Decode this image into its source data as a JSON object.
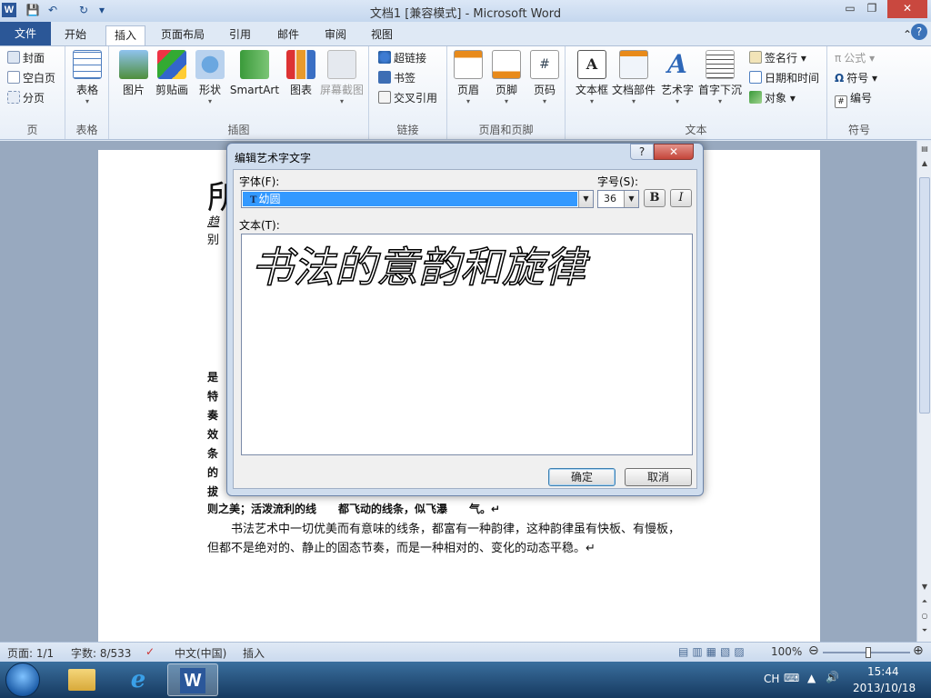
{
  "window": {
    "title": "文档1 [兼容模式] - Microsoft Word",
    "app_icon": "W"
  },
  "qat": {
    "save": "💾",
    "undo": "↶",
    "redo": "↻",
    "more": "▾"
  },
  "controls": {
    "minimize": "▭",
    "maximize": "❐",
    "close": "✕"
  },
  "tabs": [
    "文件",
    "开始",
    "插入",
    "页面布局",
    "引用",
    "邮件",
    "审阅",
    "视图"
  ],
  "ribbon": {
    "pages": {
      "label": "页",
      "items": [
        "封面",
        "空白页",
        "分页"
      ]
    },
    "tables": {
      "label": "表格",
      "button": "表格"
    },
    "illustrations": {
      "label": "插图",
      "buttons": [
        "图片",
        "剪贴画",
        "形状",
        "SmartArt",
        "图表",
        "屏幕截图"
      ]
    },
    "links": {
      "label": "链接",
      "items": [
        "超链接",
        "书签",
        "交叉引用"
      ]
    },
    "header_footer": {
      "label": "页眉和页脚",
      "buttons": [
        "页眉",
        "页脚",
        "页码"
      ]
    },
    "text": {
      "label": "文本",
      "buttons": [
        "文本框",
        "文档部件",
        "艺术字",
        "首字下沉"
      ],
      "items": [
        "签名行",
        "日期和时间",
        "对象"
      ]
    },
    "symbols": {
      "label": "符号",
      "items": [
        "公式",
        "符号",
        "编号"
      ]
    }
  },
  "document": {
    "fragment_1": "所",
    "fragment_2": "趋",
    "fragment_3": "别",
    "left_chars": [
      "是",
      "特",
      "奏",
      "效",
      "条",
      "的",
      "拔"
    ],
    "line_partial": "则之美；活泼流利的线　　都飞动的线条，似飞瀑　　气。↵",
    "para_line1": "　　书法艺术中一切优美而有意味的线条，都富有一种韵律，这种韵律虽有快板、有慢板，",
    "para_line2": "但都不是绝对的、静止的固态节奏，而是一种相对的、变化的动态平稳。↵"
  },
  "dialog": {
    "title": "编辑艺术字文字",
    "help": "?",
    "close": "✕",
    "font_label": "字体(F):",
    "font_value": "幼圆",
    "size_label": "字号(S):",
    "size_value": "36",
    "bold": "B",
    "italic": "I",
    "text_label": "文本(T):",
    "text_value": "书法的意韵和旋律",
    "ok": "确定",
    "cancel": "取消"
  },
  "status": {
    "page": "页面: 1/1",
    "words": "字数: 8/533",
    "language": "中文(中国)",
    "mode": "插入",
    "zoom": "100%",
    "zoom_level": 1.0
  },
  "taskbar": {
    "ime": "CH",
    "time": "15:44",
    "date": "2013/10/18"
  },
  "colors": {
    "file_tab": "#2b5797",
    "selection": "#3399ff",
    "close": "#c9483f"
  }
}
